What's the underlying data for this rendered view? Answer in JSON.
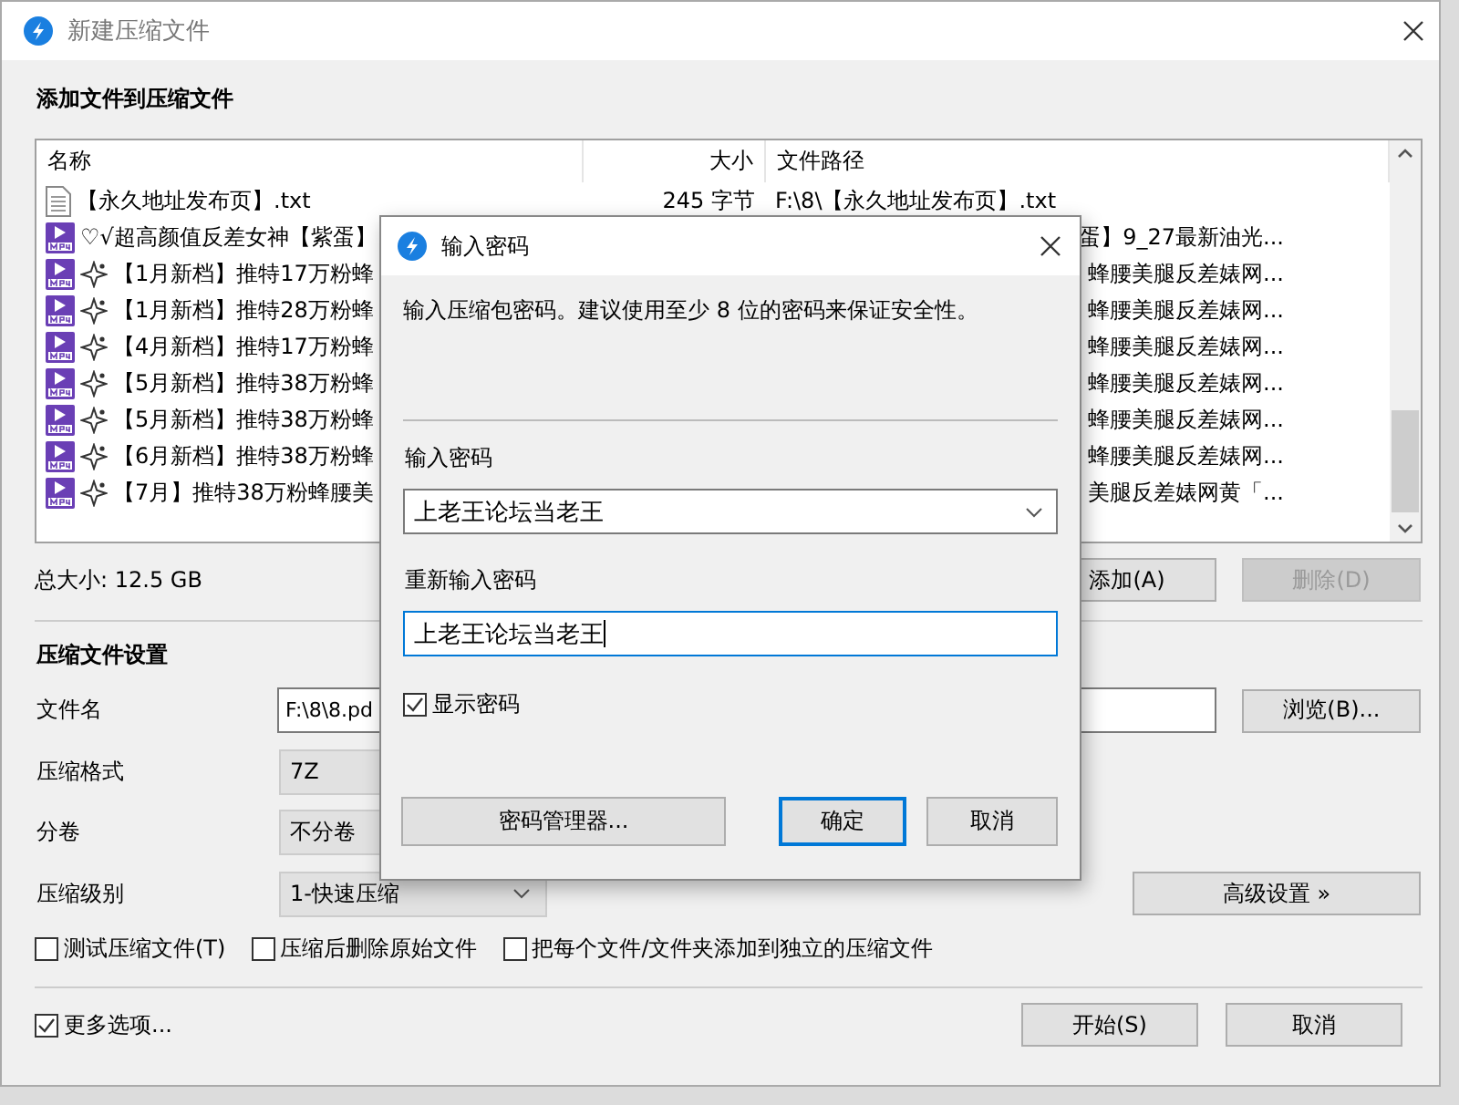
{
  "main_window": {
    "title": "新建压缩文件",
    "heading": "添加文件到压缩文件",
    "file_list": {
      "columns": [
        "名称",
        "大小",
        "文件路径"
      ],
      "rows": [
        {
          "kind": "txt",
          "sparkle": false,
          "name": "【永久地址发布页】.txt",
          "size": "245 字节",
          "path": "F:\\8\\【永久地址发布页】.txt"
        },
        {
          "kind": "mp4",
          "sparkle": false,
          "name": "♡√超高颜值反差女神【紫蛋】",
          "path": "蛋】9_27最新油光..."
        },
        {
          "kind": "mp4",
          "sparkle": true,
          "name": "【1月新档】推特17万粉蜂",
          "path": "蜂腰美腿反差婊网..."
        },
        {
          "kind": "mp4",
          "sparkle": true,
          "name": "【1月新档】推特28万粉蜂",
          "path": "蜂腰美腿反差婊网..."
        },
        {
          "kind": "mp4",
          "sparkle": true,
          "name": "【4月新档】推特17万粉蜂",
          "path": "蜂腰美腿反差婊网..."
        },
        {
          "kind": "mp4",
          "sparkle": true,
          "name": "【5月新档】推特38万粉蜂",
          "path": "蜂腰美腿反差婊网..."
        },
        {
          "kind": "mp4",
          "sparkle": true,
          "name": "【5月新档】推特38万粉蜂",
          "path": "蜂腰美腿反差婊网..."
        },
        {
          "kind": "mp4",
          "sparkle": true,
          "name": "【6月新档】推特38万粉蜂",
          "path": "蜂腰美腿反差婊网..."
        },
        {
          "kind": "mp4",
          "sparkle": true,
          "name": "【7月】推特38万粉蜂腰美",
          "path": "美腿反差婊网黄「..."
        }
      ]
    },
    "total_size": "总大小: 12.5 GB",
    "list_buttons": [
      {
        "label": "添加(A)",
        "disabled": false
      },
      {
        "label": "删除(D)",
        "disabled": true
      }
    ],
    "settings": {
      "title": "压缩文件设置",
      "fields": [
        {
          "kind": "input",
          "label": "文件名",
          "value": "F:\\8\\8.pd"
        },
        {
          "kind": "static",
          "label": "压缩格式",
          "value": "7Z"
        },
        {
          "kind": "static",
          "label": "分卷",
          "value": "不分卷"
        },
        {
          "kind": "dropdown",
          "label": "压缩级别",
          "value": "1-快速压缩"
        }
      ],
      "browse_button": "浏览(B)...",
      "advanced_button": "高级设置 »"
    },
    "options": [
      {
        "label": "测试压缩文件(T)",
        "checked": false
      },
      {
        "label": "压缩后删除原始文件",
        "checked": false
      },
      {
        "label": "把每个文件/文件夹添加到独立的压缩文件",
        "checked": false
      }
    ],
    "more_options": {
      "label": "更多选项...",
      "checked": true
    },
    "buttons": [
      "开始(S)",
      "取消"
    ]
  },
  "dialog": {
    "title": "输入密码",
    "message": "输入压缩包密码。建议使用至少 8 位的密码来保证安全性。",
    "password_label": "输入密码",
    "password_value": "上老王论坛当老王",
    "confirm_label": "重新输入密码",
    "confirm_value": "上老王论坛当老王",
    "show_password": {
      "label": "显示密码",
      "checked": true
    },
    "manager_button": "密码管理器...",
    "ok_button": "确定",
    "cancel_button": "取消"
  }
}
